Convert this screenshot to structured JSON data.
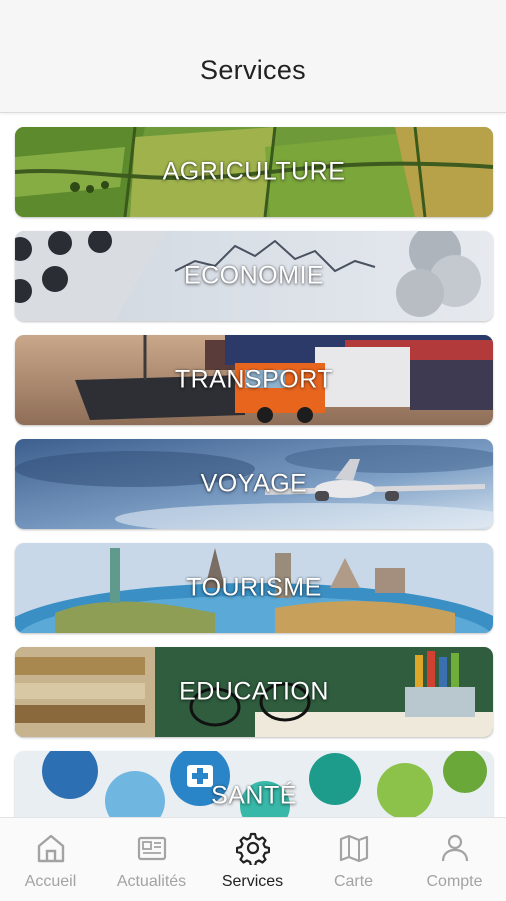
{
  "header": {
    "title": "Services"
  },
  "services": [
    {
      "label": "AGRICULTURE"
    },
    {
      "label": "ECONOMIE"
    },
    {
      "label": "TRANSPORT"
    },
    {
      "label": "VOYAGE"
    },
    {
      "label": "TOURISME"
    },
    {
      "label": "EDUCATION"
    },
    {
      "label": "SANTÉ"
    }
  ],
  "tabbar": {
    "tabs": [
      {
        "label": "Accueil",
        "icon": "home-icon"
      },
      {
        "label": "Actualités",
        "icon": "newspaper-icon"
      },
      {
        "label": "Services",
        "icon": "gear-icon",
        "active": true
      },
      {
        "label": "Carte",
        "icon": "map-icon"
      },
      {
        "label": "Compte",
        "icon": "user-icon"
      }
    ]
  },
  "colors": {
    "active_tab": "#222222",
    "inactive_tab": "#a3a3a3",
    "header_bg": "#f6f6f6"
  }
}
